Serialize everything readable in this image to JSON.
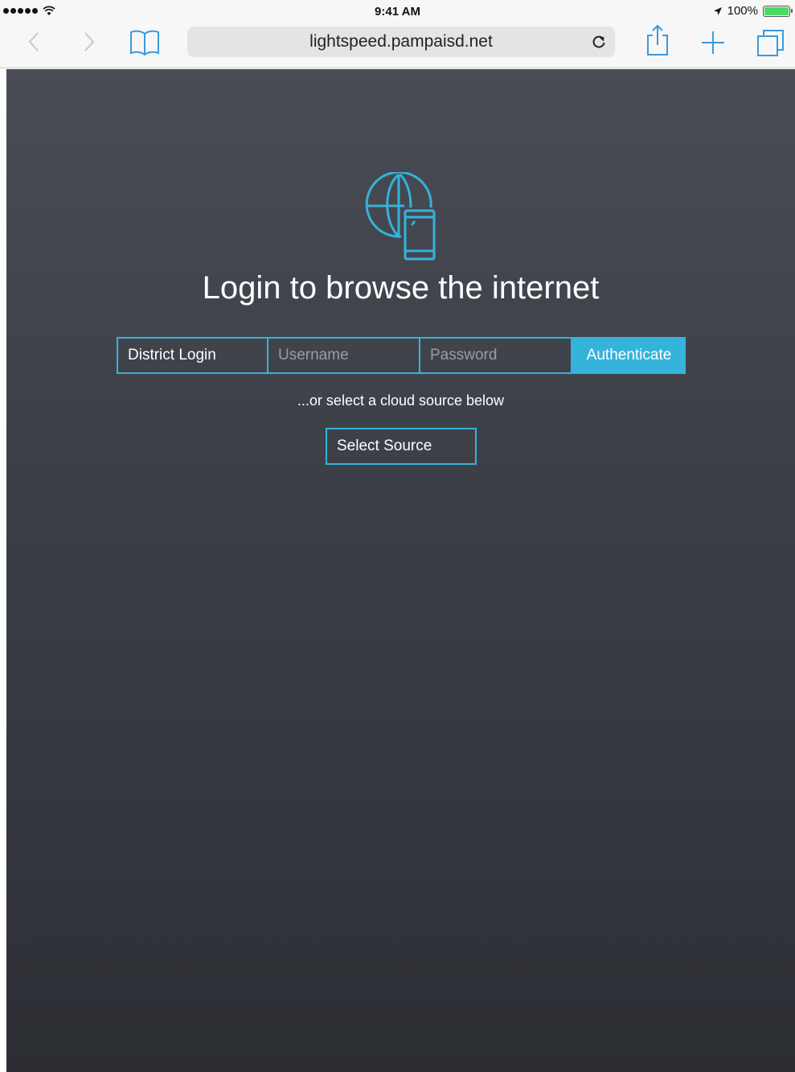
{
  "status_bar": {
    "time": "9:41 AM",
    "battery_percent": "100%",
    "battery_level": 1.0
  },
  "browser": {
    "url": "lightspeed.pampaisd.net"
  },
  "page": {
    "title": "Login to browse the internet",
    "district_login_label": "District Login",
    "username_placeholder": "Username",
    "password_placeholder": "Password",
    "authenticate_label": "Authenticate",
    "or_text": "...or select a cloud source below",
    "select_source_label": "Select Source"
  },
  "colors": {
    "accent": "#35b3da",
    "background_top": "#4a4c55",
    "background_bottom": "#2c2e34",
    "toolbar_icon": "#3a9ad9"
  },
  "icons": {
    "back": "chevron-left-icon",
    "forward": "chevron-right-icon",
    "bookmarks": "book-icon",
    "reload": "reload-icon",
    "share": "share-icon",
    "new_tab": "plus-icon",
    "tabs": "tabs-icon",
    "hero": "globe-phone-icon"
  }
}
